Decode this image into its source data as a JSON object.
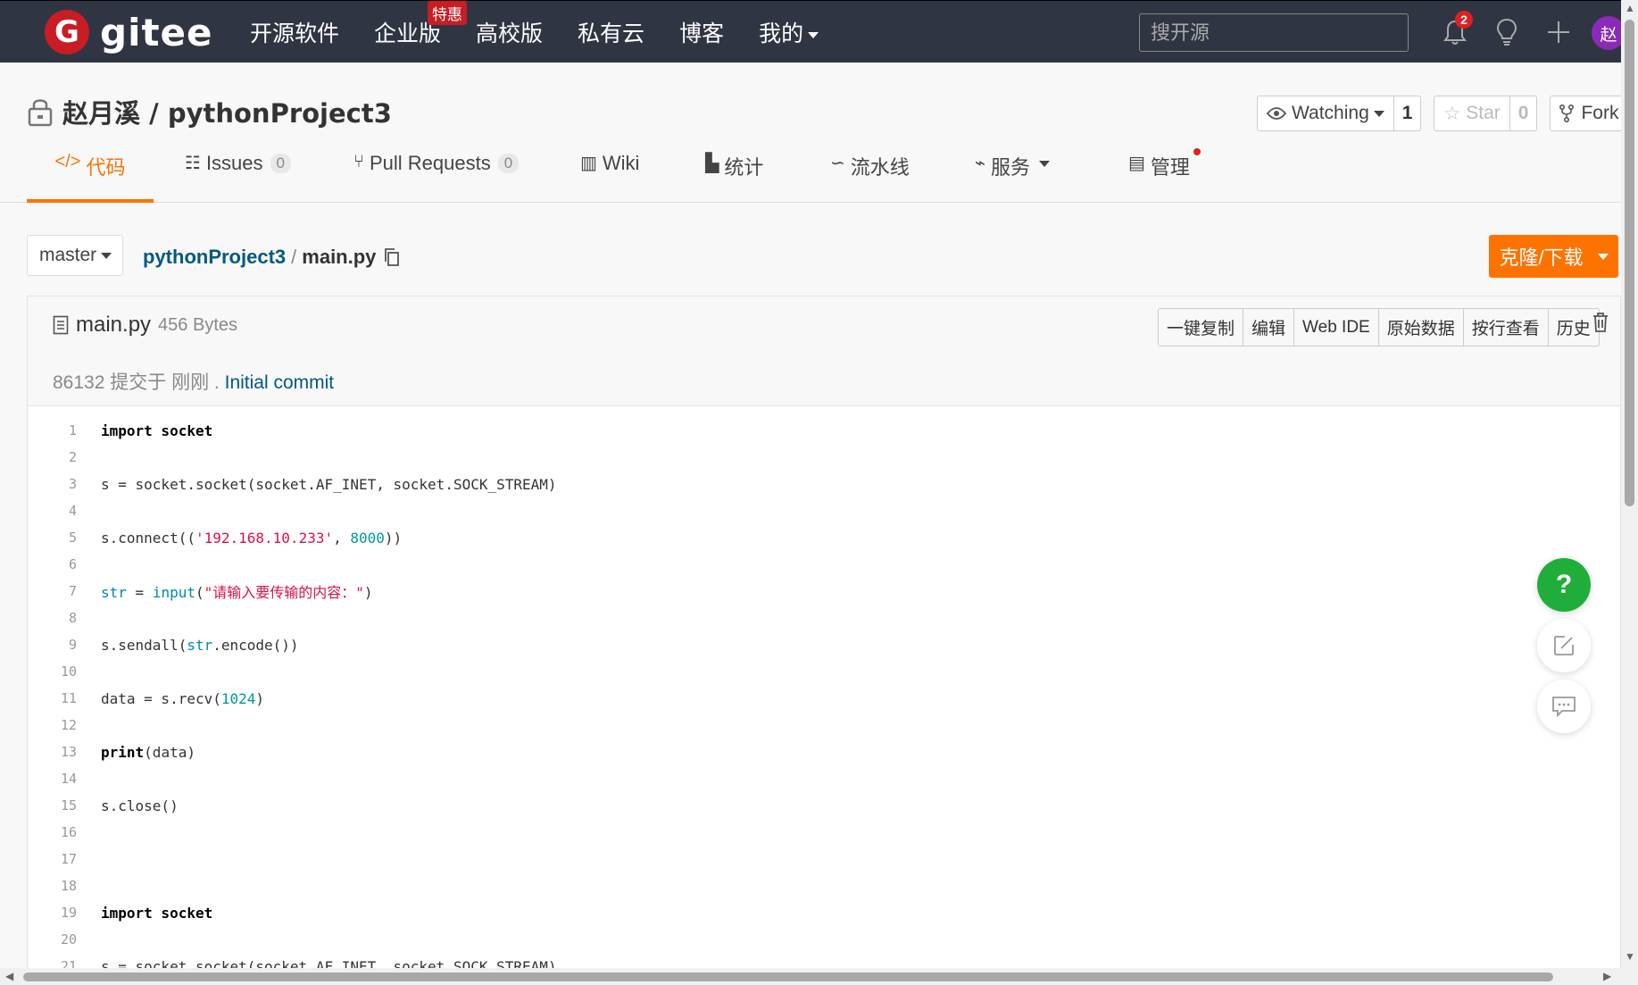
{
  "nav": {
    "logo_mark": "G",
    "logo_text": "gitee",
    "links": [
      "开源软件",
      "企业版",
      "高校版",
      "私有云",
      "博客",
      "我的"
    ],
    "enterprise_badge": "特惠",
    "search_placeholder": "搜开源",
    "notification_count": "2",
    "avatar_text": "赵"
  },
  "repo": {
    "owner": "赵月溪",
    "separator": "/",
    "name": "pythonProject3",
    "watch_label": "Watching",
    "watch_count": "1",
    "star_label": "Star",
    "star_count": "0",
    "fork_label": "Fork"
  },
  "tabs": {
    "code": "代码",
    "issues": "Issues",
    "issues_count": "0",
    "pulls": "Pull Requests",
    "pulls_count": "0",
    "wiki": "Wiki",
    "stats": "统计",
    "pipeline": "流水线",
    "services": "服务",
    "manage": "管理"
  },
  "branch": "master",
  "breadcrumb": {
    "repo": "pythonProject3",
    "sep": "/",
    "file": "main.py"
  },
  "clone_label": "克隆/下载",
  "file": {
    "name": "main.py",
    "size": "456 Bytes",
    "actions": [
      "一键复制",
      "编辑",
      "Web IDE",
      "原始数据",
      "按行查看",
      "历史"
    ],
    "commit_hash": "86132",
    "commit_meta": "提交于 刚刚 .",
    "commit_msg": "Initial commit"
  },
  "code_lines": [
    [
      {
        "t": "import socket",
        "c": "kw"
      }
    ],
    [],
    [
      {
        "t": "s = socket.socket(socket.AF_INET, socket.SOCK_STREAM)"
      }
    ],
    [],
    [
      {
        "t": "s.connect(("
      },
      {
        "t": "'192.168.10.233'",
        "c": "str"
      },
      {
        "t": ", "
      },
      {
        "t": "8000",
        "c": "num"
      },
      {
        "t": "))"
      }
    ],
    [],
    [
      {
        "t": "str",
        "c": "bi"
      },
      {
        "t": " = "
      },
      {
        "t": "input",
        "c": "bi"
      },
      {
        "t": "("
      },
      {
        "t": "\"请输入要传输的内容：\"",
        "c": "str"
      },
      {
        "t": ")"
      }
    ],
    [],
    [
      {
        "t": "s.sendall("
      },
      {
        "t": "str",
        "c": "bi"
      },
      {
        "t": ".encode())"
      }
    ],
    [],
    [
      {
        "t": "data = s.recv("
      },
      {
        "t": "1024",
        "c": "num"
      },
      {
        "t": ")"
      }
    ],
    [],
    [
      {
        "t": "print",
        "c": "kw"
      },
      {
        "t": "(data)"
      }
    ],
    [],
    [
      {
        "t": "s.close()"
      }
    ],
    [],
    [],
    [],
    [
      {
        "t": "import socket",
        "c": "kw"
      }
    ],
    [],
    [
      {
        "t": "s = socket.socket(socket.AF_INET, socket.SOCK_STREAM)"
      }
    ]
  ],
  "help_label": "?",
  "colors": {
    "brand": "#c71d23",
    "accent": "#fe7300",
    "nav_bg": "#2f3542",
    "link": "#005980",
    "help": "#1fae3a"
  }
}
